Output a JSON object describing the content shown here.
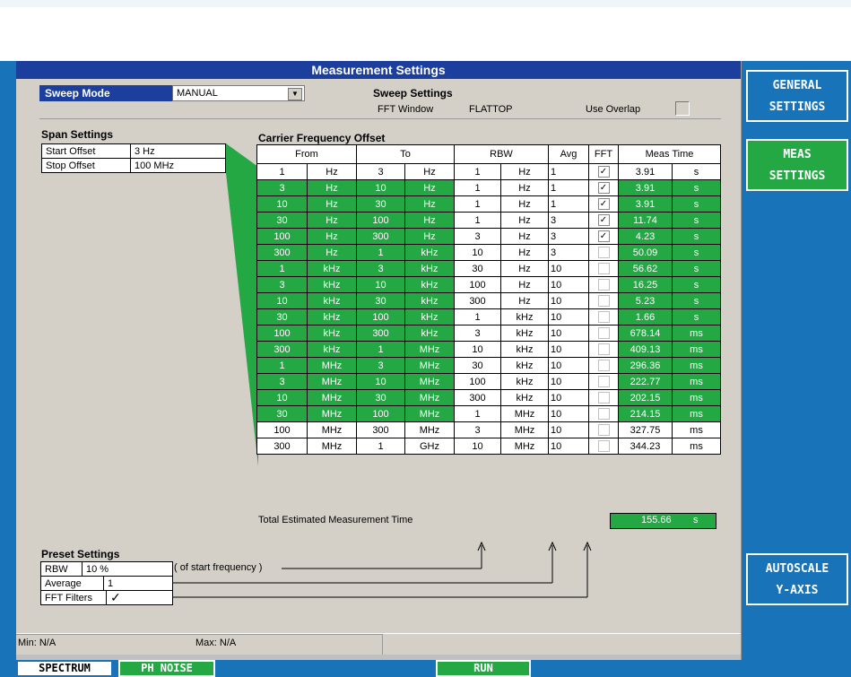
{
  "window": {
    "title": "Measurement Settings"
  },
  "sweep": {
    "mode_label": "Sweep Mode",
    "mode_value": "MANUAL",
    "settings_title": "Sweep Settings",
    "fft_window_label": "FFT Window",
    "fft_window_value": "FLATTOP",
    "use_overlap_label": "Use Overlap"
  },
  "span": {
    "title": "Span Settings",
    "start_label": "Start Offset",
    "start_value": "3 Hz",
    "stop_label": "Stop Offset",
    "stop_value": "100 MHz"
  },
  "table": {
    "title": "Carrier Frequency Offset",
    "headers": {
      "from": "From",
      "to": "To",
      "rbw": "RBW",
      "avg": "Avg",
      "fft": "FFT",
      "meas": "Meas Time"
    },
    "rows": [
      {
        "f": "1",
        "fu": "Hz",
        "t": "3",
        "tu": "Hz",
        "r": "1",
        "ru": "Hz",
        "a": "1",
        "fft": true,
        "m": "3.91",
        "mu": "s",
        "green": false
      },
      {
        "f": "3",
        "fu": "Hz",
        "t": "10",
        "tu": "Hz",
        "r": "1",
        "ru": "Hz",
        "a": "1",
        "fft": true,
        "m": "3.91",
        "mu": "s",
        "green": true
      },
      {
        "f": "10",
        "fu": "Hz",
        "t": "30",
        "tu": "Hz",
        "r": "1",
        "ru": "Hz",
        "a": "1",
        "fft": true,
        "m": "3.91",
        "mu": "s",
        "green": true
      },
      {
        "f": "30",
        "fu": "Hz",
        "t": "100",
        "tu": "Hz",
        "r": "1",
        "ru": "Hz",
        "a": "3",
        "fft": true,
        "m": "11.74",
        "mu": "s",
        "green": true
      },
      {
        "f": "100",
        "fu": "Hz",
        "t": "300",
        "tu": "Hz",
        "r": "3",
        "ru": "Hz",
        "a": "3",
        "fft": true,
        "m": "4.23",
        "mu": "s",
        "green": true
      },
      {
        "f": "300",
        "fu": "Hz",
        "t": "1",
        "tu": "kHz",
        "r": "10",
        "ru": "Hz",
        "a": "3",
        "fft": false,
        "m": "50.09",
        "mu": "s",
        "green": true
      },
      {
        "f": "1",
        "fu": "kHz",
        "t": "3",
        "tu": "kHz",
        "r": "30",
        "ru": "Hz",
        "a": "10",
        "fft": false,
        "m": "56.62",
        "mu": "s",
        "green": true
      },
      {
        "f": "3",
        "fu": "kHz",
        "t": "10",
        "tu": "kHz",
        "r": "100",
        "ru": "Hz",
        "a": "10",
        "fft": false,
        "m": "16.25",
        "mu": "s",
        "green": true
      },
      {
        "f": "10",
        "fu": "kHz",
        "t": "30",
        "tu": "kHz",
        "r": "300",
        "ru": "Hz",
        "a": "10",
        "fft": false,
        "m": "5.23",
        "mu": "s",
        "green": true
      },
      {
        "f": "30",
        "fu": "kHz",
        "t": "100",
        "tu": "kHz",
        "r": "1",
        "ru": "kHz",
        "a": "10",
        "fft": false,
        "m": "1.66",
        "mu": "s",
        "green": true
      },
      {
        "f": "100",
        "fu": "kHz",
        "t": "300",
        "tu": "kHz",
        "r": "3",
        "ru": "kHz",
        "a": "10",
        "fft": false,
        "m": "678.14",
        "mu": "ms",
        "green": true
      },
      {
        "f": "300",
        "fu": "kHz",
        "t": "1",
        "tu": "MHz",
        "r": "10",
        "ru": "kHz",
        "a": "10",
        "fft": false,
        "m": "409.13",
        "mu": "ms",
        "green": true
      },
      {
        "f": "1",
        "fu": "MHz",
        "t": "3",
        "tu": "MHz",
        "r": "30",
        "ru": "kHz",
        "a": "10",
        "fft": false,
        "m": "296.36",
        "mu": "ms",
        "green": true
      },
      {
        "f": "3",
        "fu": "MHz",
        "t": "10",
        "tu": "MHz",
        "r": "100",
        "ru": "kHz",
        "a": "10",
        "fft": false,
        "m": "222.77",
        "mu": "ms",
        "green": true
      },
      {
        "f": "10",
        "fu": "MHz",
        "t": "30",
        "tu": "MHz",
        "r": "300",
        "ru": "kHz",
        "a": "10",
        "fft": false,
        "m": "202.15",
        "mu": "ms",
        "green": true
      },
      {
        "f": "30",
        "fu": "MHz",
        "t": "100",
        "tu": "MHz",
        "r": "1",
        "ru": "MHz",
        "a": "10",
        "fft": false,
        "m": "214.15",
        "mu": "ms",
        "green": true
      },
      {
        "f": "100",
        "fu": "MHz",
        "t": "300",
        "tu": "MHz",
        "r": "3",
        "ru": "MHz",
        "a": "10",
        "fft": false,
        "m": "327.75",
        "mu": "ms",
        "green": false
      },
      {
        "f": "300",
        "fu": "MHz",
        "t": "1",
        "tu": "GHz",
        "r": "10",
        "ru": "MHz",
        "a": "10",
        "fft": false,
        "m": "344.23",
        "mu": "ms",
        "green": false
      }
    ],
    "total_label": "Total Estimated Measurement Time",
    "total_value": "155.66",
    "total_unit": "s"
  },
  "preset": {
    "title": "Preset Settings",
    "rbw_label": "RBW",
    "rbw_value": "10 %",
    "rbw_note": "( of start frequency )",
    "avg_label": "Average",
    "avg_value": "1",
    "fft_label": "FFT Filters",
    "fft_checked": true
  },
  "status": {
    "min": "Min: N/A",
    "max": "Max: N/A"
  },
  "softkeys": [
    {
      "line1": "GENERAL",
      "line2": "SETTINGS",
      "active": false
    },
    {
      "line1": "MEAS",
      "line2": "SETTINGS",
      "active": true
    },
    {
      "line1": "AUTOSCALE",
      "line2": "Y-AXIS",
      "active": false
    }
  ],
  "bottom": {
    "spectrum": "SPECTRUM",
    "phnoise": "PH NOISE",
    "run": "RUN"
  },
  "colors": {
    "green": "#24a844",
    "title_blue": "#1c3f9e",
    "stage_blue": "#1973b8",
    "panel_gray": "#d4d0c8"
  }
}
